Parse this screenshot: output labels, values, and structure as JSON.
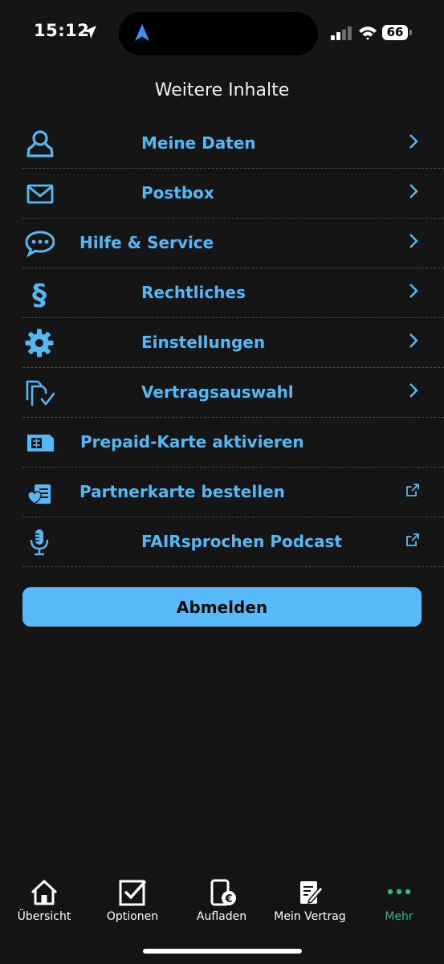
{
  "status": {
    "time": "15:12",
    "battery": "66"
  },
  "page": {
    "title": "Weitere Inhalte"
  },
  "menu": [
    {
      "label": "Meine Daten",
      "icon": "user-icon",
      "action": "chevron"
    },
    {
      "label": "Postbox",
      "icon": "mail-icon",
      "action": "chevron"
    },
    {
      "label": "Hilfe & Service",
      "icon": "chat-bubble-icon",
      "action": "chevron"
    },
    {
      "label": "Rechtliches",
      "icon": "paragraph-icon",
      "action": "chevron"
    },
    {
      "label": "Einstellungen",
      "icon": "gear-icon",
      "action": "chevron"
    },
    {
      "label": "Vertragsauswahl",
      "icon": "contracts-check-icon",
      "action": "chevron"
    },
    {
      "label": "Prepaid-Karte aktivieren",
      "icon": "sim-card-icon",
      "action": "none"
    },
    {
      "label": "Partnerkarte bestellen",
      "icon": "partner-card-icon",
      "action": "external"
    },
    {
      "label": "FAIRsprochen Podcast",
      "icon": "microphone-icon",
      "action": "external"
    }
  ],
  "logout_label": "Abmelden",
  "tabs": [
    {
      "label": "Übersicht",
      "icon": "home-icon",
      "active": false
    },
    {
      "label": "Optionen",
      "icon": "checkbox-icon",
      "active": false
    },
    {
      "label": "Aufladen",
      "icon": "phone-euro-icon",
      "active": false
    },
    {
      "label": "Mein Vertrag",
      "icon": "contract-edit-icon",
      "active": false
    },
    {
      "label": "Mehr",
      "icon": "more-dots-icon",
      "active": true
    }
  ],
  "colors": {
    "accent": "#55b8f5",
    "button": "#58baf8",
    "active_tab": "#29b59a",
    "background": "#151515"
  }
}
